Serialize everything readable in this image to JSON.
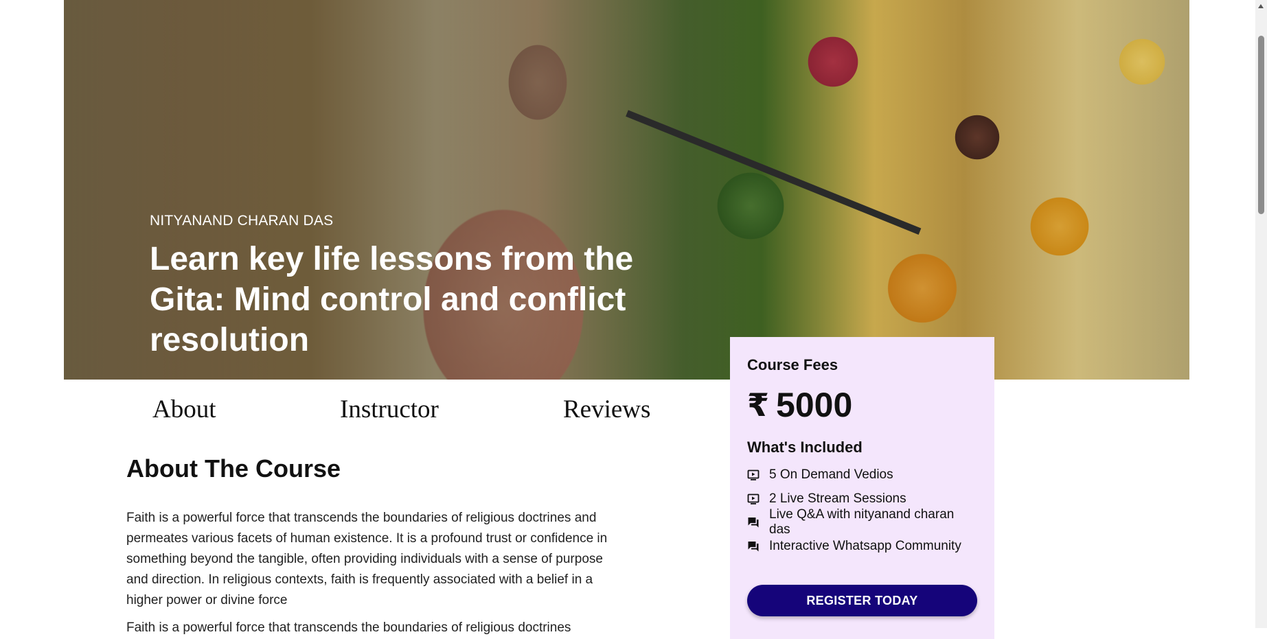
{
  "hero": {
    "subtitle": "NITYANAND CHARAN DAS",
    "title": "Learn key life lessons from the Gita: Mind control and conflict resolution"
  },
  "tabs": [
    {
      "label": "About"
    },
    {
      "label": "Instructor"
    },
    {
      "label": "Reviews"
    }
  ],
  "about": {
    "heading": "About The Course",
    "paragraph": "Faith is a powerful force that transcends the boundaries of religious doctrines and permeates various facets of human existence. It is a profound trust or confidence in something beyond the tangible, often providing individuals with a sense of purpose and direction. In religious contexts, faith is frequently associated with a belief in a higher power or divine force",
    "paragraph2": "Faith is a powerful force that transcends the boundaries of religious doctrines"
  },
  "card": {
    "label": "Course Fees",
    "currency": "₹",
    "price": "5000",
    "included_title": "What's Included",
    "features": [
      {
        "text": "5 On Demand Vedios",
        "icon": "video-icon"
      },
      {
        "text": "2 Live Stream Sessions",
        "icon": "video-icon"
      },
      {
        "text": "Live Q&A with nityanand charan das",
        "icon": "chat-icon"
      },
      {
        "text": "Interactive Whatsapp Community",
        "icon": "chat-icon"
      }
    ],
    "register_label": "REGISTER TODAY"
  },
  "colors": {
    "card_bg": "#f4e6fc",
    "button_bg": "#15047a",
    "button_text": "#ffffff"
  }
}
